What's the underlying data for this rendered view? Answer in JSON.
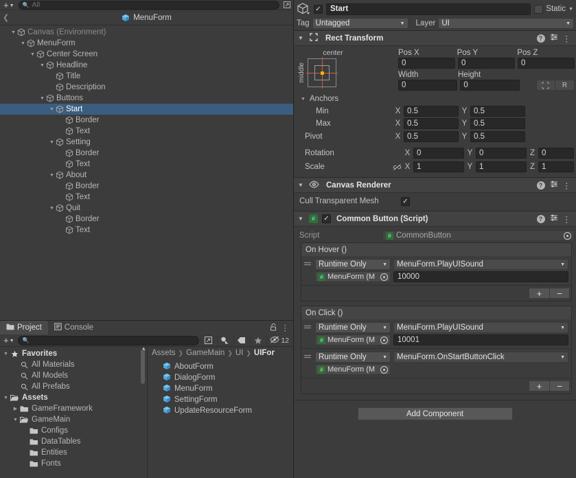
{
  "hierarchy": {
    "toolbar": {
      "add_label": "+",
      "search_placeholder": "All",
      "search_icon": "search-icon"
    },
    "breadcrumb_title": "MenuForm",
    "rows": [
      {
        "label": "Canvas (Environment)",
        "depth": 1,
        "expanded": true,
        "dim": true,
        "selected": false
      },
      {
        "label": "MenuForm",
        "depth": 2,
        "expanded": true,
        "dim": false,
        "selected": false
      },
      {
        "label": "Center Screen",
        "depth": 3,
        "expanded": true,
        "dim": false,
        "selected": false
      },
      {
        "label": "Headline",
        "depth": 4,
        "expanded": true,
        "dim": false,
        "selected": false
      },
      {
        "label": "Title",
        "depth": 5,
        "expanded": false,
        "dim": false,
        "selected": false
      },
      {
        "label": "Description",
        "depth": 5,
        "expanded": false,
        "dim": false,
        "selected": false
      },
      {
        "label": "Buttons",
        "depth": 4,
        "expanded": true,
        "dim": false,
        "selected": false
      },
      {
        "label": "Start",
        "depth": 5,
        "expanded": true,
        "dim": false,
        "selected": true
      },
      {
        "label": "Border",
        "depth": 6,
        "expanded": false,
        "dim": false,
        "selected": false
      },
      {
        "label": "Text",
        "depth": 6,
        "expanded": false,
        "dim": false,
        "selected": false
      },
      {
        "label": "Setting",
        "depth": 5,
        "expanded": true,
        "dim": false,
        "selected": false
      },
      {
        "label": "Border",
        "depth": 6,
        "expanded": false,
        "dim": false,
        "selected": false
      },
      {
        "label": "Text",
        "depth": 6,
        "expanded": false,
        "dim": false,
        "selected": false
      },
      {
        "label": "About",
        "depth": 5,
        "expanded": true,
        "dim": false,
        "selected": false
      },
      {
        "label": "Border",
        "depth": 6,
        "expanded": false,
        "dim": false,
        "selected": false
      },
      {
        "label": "Text",
        "depth": 6,
        "expanded": false,
        "dim": false,
        "selected": false
      },
      {
        "label": "Quit",
        "depth": 5,
        "expanded": true,
        "dim": false,
        "selected": false
      },
      {
        "label": "Border",
        "depth": 6,
        "expanded": false,
        "dim": false,
        "selected": false
      },
      {
        "label": "Text",
        "depth": 6,
        "expanded": false,
        "dim": false,
        "selected": false
      }
    ]
  },
  "project": {
    "tabs": [
      {
        "label": "Project",
        "icon": "folder-icon",
        "active": true
      },
      {
        "label": "Console",
        "icon": "console-icon",
        "active": false
      }
    ],
    "lock_icon": "lock-open-icon",
    "menu_icon": "kebab-menu-icon",
    "toolbar": {
      "add_label": "+",
      "search_placeholder": "",
      "search_icon": "search-icon",
      "save_search_icon": "save-search-icon",
      "type_filter_icon": "type-filter-icon",
      "label_filter_icon": "label-filter-icon",
      "favorite_icon": "star-icon",
      "hidden_icon": "eye-slash-icon",
      "hidden_count": "12"
    },
    "tree": [
      {
        "label": "Favorites",
        "depth": 0,
        "expanded": true,
        "kind": "star",
        "bold": true
      },
      {
        "label": "All Materials",
        "depth": 1,
        "expanded": null,
        "kind": "search",
        "bold": false
      },
      {
        "label": "All Models",
        "depth": 1,
        "expanded": null,
        "kind": "search",
        "bold": false
      },
      {
        "label": "All Prefabs",
        "depth": 1,
        "expanded": null,
        "kind": "search",
        "bold": false
      },
      {
        "label": "Assets",
        "depth": 0,
        "expanded": true,
        "kind": "folder-open",
        "bold": true
      },
      {
        "label": "GameFramework",
        "depth": 1,
        "expanded": false,
        "kind": "folder",
        "bold": false
      },
      {
        "label": "GameMain",
        "depth": 1,
        "expanded": true,
        "kind": "folder-open",
        "bold": false
      },
      {
        "label": "Configs",
        "depth": 2,
        "expanded": null,
        "kind": "folder",
        "bold": false
      },
      {
        "label": "DataTables",
        "depth": 2,
        "expanded": null,
        "kind": "folder",
        "bold": false
      },
      {
        "label": "Entities",
        "depth": 2,
        "expanded": null,
        "kind": "folder",
        "bold": false
      },
      {
        "label": "Fonts",
        "depth": 2,
        "expanded": null,
        "kind": "folder",
        "bold": false
      }
    ],
    "breadcrumb": [
      "Assets",
      "GameMain",
      "UI",
      "UIFor"
    ],
    "assets": [
      {
        "label": "AboutForm",
        "icon": "prefab-icon"
      },
      {
        "label": "DialogForm",
        "icon": "prefab-icon"
      },
      {
        "label": "MenuForm",
        "icon": "prefab-icon"
      },
      {
        "label": "SettingForm",
        "icon": "prefab-icon"
      },
      {
        "label": "UpdateResourceForm",
        "icon": "prefab-icon"
      }
    ]
  },
  "inspector": {
    "game_object": {
      "enabled_checkbox": "✓",
      "name": "Start",
      "static_label": "Static",
      "tag_label": "Tag",
      "tag_value": "Untagged",
      "layer_label": "Layer",
      "layer_value": "UI"
    },
    "rect_transform": {
      "title": "Rect Transform",
      "anchor_preset_top": "center",
      "anchor_preset_left": "middle",
      "pos_x_label": "Pos X",
      "pos_y_label": "Pos Y",
      "pos_z_label": "Pos Z",
      "pos_x": "0",
      "pos_y": "0",
      "pos_z": "0",
      "width_label": "Width",
      "height_label": "Height",
      "width": "0",
      "height": "0",
      "blueprint_icon": "blueprint-icon",
      "raw_label": "R",
      "anchors_label": "Anchors",
      "min_label": "Min",
      "max_label": "Max",
      "pivot_label": "Pivot",
      "anchor_min_x": "0.5",
      "anchor_min_y": "0.5",
      "anchor_max_x": "0.5",
      "anchor_max_y": "0.5",
      "pivot_x": "0.5",
      "pivot_y": "0.5",
      "rotation_label": "Rotation",
      "rotation_x": "0",
      "rotation_y": "0",
      "rotation_z": "0",
      "scale_label": "Scale",
      "scale_x": "1",
      "scale_y": "1",
      "scale_z": "1",
      "axis_x": "X",
      "axis_y": "Y",
      "axis_z": "Z",
      "scale_link_icon": "link-broken-icon"
    },
    "canvas_renderer": {
      "title": "Canvas Renderer",
      "cull_label": "Cull Transparent Mesh",
      "cull_checked": "✓"
    },
    "common_button": {
      "title": "Common Button (Script)",
      "enabled_checkbox": "✓",
      "script_label": "Script",
      "script_value": "CommonButton",
      "on_hover": {
        "title": "On Hover ()",
        "entries": [
          {
            "mode": "Runtime Only",
            "method": "MenuForm.PlayUISound",
            "target": "MenuForm (M",
            "arg": "10000"
          }
        ],
        "add_label": "+",
        "remove_label": "−"
      },
      "on_click": {
        "title": "On Click ()",
        "entries": [
          {
            "mode": "Runtime Only",
            "method": "MenuForm.PlayUISound",
            "target": "MenuForm (M",
            "arg": "10001"
          },
          {
            "mode": "Runtime Only",
            "method": "MenuForm.OnStartButtonClick",
            "target": "MenuForm (M",
            "arg": ""
          }
        ],
        "add_label": "+",
        "remove_label": "−"
      }
    },
    "add_component_label": "Add Component"
  }
}
